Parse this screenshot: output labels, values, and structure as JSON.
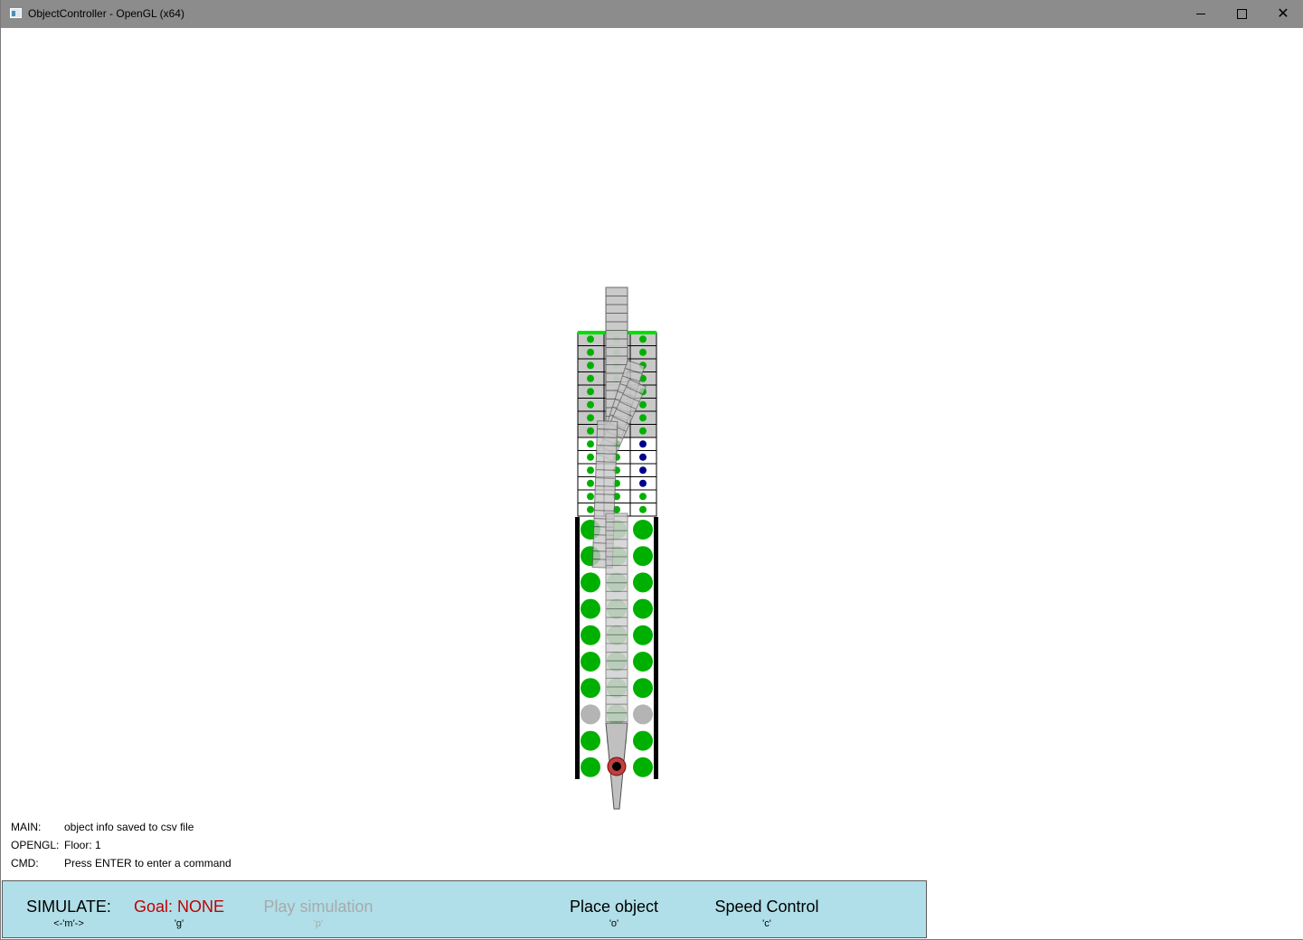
{
  "window": {
    "title": "ObjectController - OpenGL (x64)",
    "icon": "app-window-icon",
    "controls": [
      "minimize-icon",
      "maximize-icon",
      "close-icon"
    ]
  },
  "colors": {
    "titlebar": "#8c8c8c",
    "menubar_bg": "#b0dfe9",
    "goal_red": "#c00000",
    "disabled_gray": "#a9a9a9",
    "green_dot": "#00b000",
    "blue_dot": "#00008b",
    "highlight_green": "#00e000"
  },
  "log": {
    "main_key": "MAIN:",
    "main_msg": "object info saved to csv file",
    "opengl_key": "OPENGL:",
    "opengl_msg": "Floor: 1",
    "cmd_key": "CMD:",
    "cmd_msg": "Press ENTER to enter a command"
  },
  "menu": {
    "simulate": {
      "label": "SIMULATE:",
      "key": "<-'m'->"
    },
    "goal": {
      "label": "Goal: NONE",
      "key": "'g'"
    },
    "play": {
      "label": "Play simulation",
      "key": "'p'",
      "enabled": false
    },
    "place": {
      "label": "Place object",
      "key": "'o'"
    },
    "speed": {
      "label": "Speed Control",
      "key": "'c'"
    }
  }
}
